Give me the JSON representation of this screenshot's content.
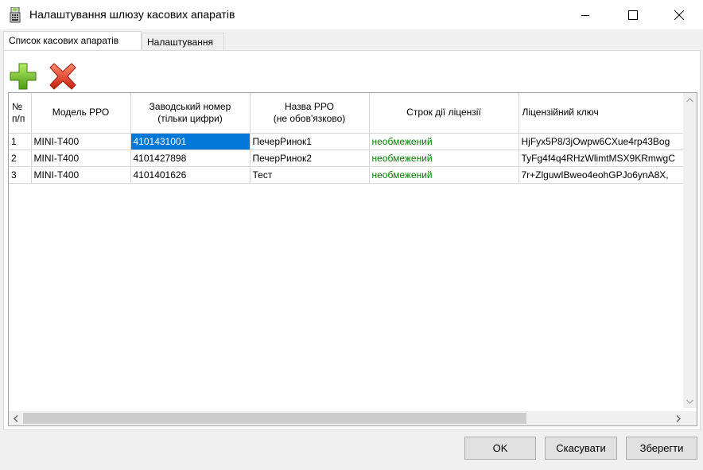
{
  "window": {
    "title": "Налаштування шлюзу касових апаратів"
  },
  "tabs": [
    {
      "label": "Список касових апаратів",
      "active": true
    },
    {
      "label": "Налаштування",
      "active": false
    }
  ],
  "toolbar": {
    "add_icon": "plus-icon",
    "delete_icon": "x-icon",
    "add_color": "#6cc024",
    "delete_color": "#e2382a"
  },
  "table": {
    "headers": [
      {
        "line1": "№",
        "line2": "п/п"
      },
      {
        "line1": "Модель РРО",
        "line2": ""
      },
      {
        "line1": "Заводський номер",
        "line2": "(тільки цифри)"
      },
      {
        "line1": "Назва РРО",
        "line2": "(не обов'язково)"
      },
      {
        "line1": "Строк дії ліцензії",
        "line2": ""
      },
      {
        "line1": "Ліцензійний ключ",
        "line2": ""
      }
    ],
    "rows": [
      {
        "num": "1",
        "model": "MINI-T400",
        "serial": "4101431001",
        "name": "ПечерРинок1",
        "license_term": "необмежений",
        "key": "HjFyx5P8/3jOwpw6CXue4rp43Bog"
      },
      {
        "num": "2",
        "model": "MINI-T400",
        "serial": "4101427898",
        "name": "ПечерРинок2",
        "license_term": "необмежений",
        "key": "TyFg4f4q4RHzWlimtMSX9KRmwgC"
      },
      {
        "num": "3",
        "model": "MINI-T400",
        "serial": "4101401626",
        "name": "Тест",
        "license_term": "необмежений",
        "key": "7r+ZlguwIBweo4eohGPJo6ynA8X,"
      }
    ],
    "selected_cell": {
      "row": 0,
      "column": "serial"
    },
    "green_color": "#008000",
    "selection_color": "#0078d7"
  },
  "buttons": {
    "ok": "OK",
    "cancel": "Скасувати",
    "save": "Зберегти"
  }
}
